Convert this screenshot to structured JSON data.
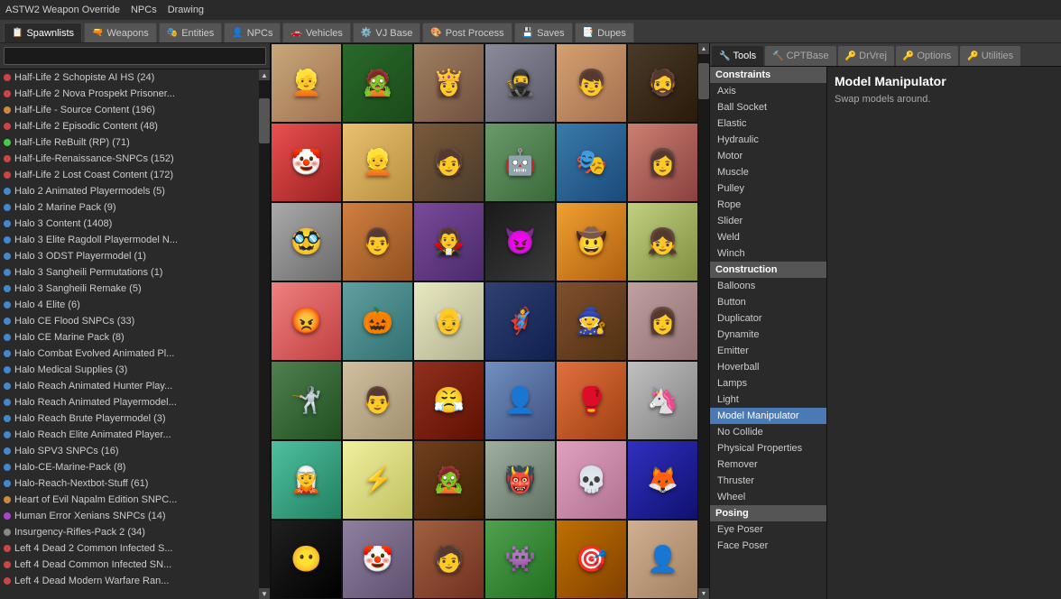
{
  "menubar": {
    "items": [
      "ASTW2 Weapon Override",
      "NPCs",
      "Drawing"
    ]
  },
  "tabs": [
    {
      "label": "Spawnlists",
      "icon": "📋",
      "active": true
    },
    {
      "label": "Weapons",
      "icon": "🔫",
      "active": false
    },
    {
      "label": "Entities",
      "icon": "🎭",
      "active": false
    },
    {
      "label": "NPCs",
      "icon": "👤",
      "active": false
    },
    {
      "label": "Vehicles",
      "icon": "🚗",
      "active": false
    },
    {
      "label": "VJ Base",
      "icon": "⚙️",
      "active": false
    },
    {
      "label": "Post Process",
      "icon": "🎨",
      "active": false
    },
    {
      "label": "Saves",
      "icon": "💾",
      "active": false
    },
    {
      "label": "Dupes",
      "icon": "📑",
      "active": false
    }
  ],
  "search": {
    "placeholder": ""
  },
  "list_items": [
    {
      "label": "Half-Life 2 Schopiste AI HS (24)",
      "color": "red"
    },
    {
      "label": "Half-Life 2 Nova Prospekt Prisoner...",
      "color": "red"
    },
    {
      "label": "Half-Life - Source Content (196)",
      "color": "orange"
    },
    {
      "label": "Half-Life 2 Episodic Content (48)",
      "color": "red"
    },
    {
      "label": "Half-Life ReBuilt (RP) (71)",
      "color": "green"
    },
    {
      "label": "Half-Life-Renaissance-SNPCs (152)",
      "color": "red"
    },
    {
      "label": "Half-Life 2 Lost Coast Content (172)",
      "color": "red"
    },
    {
      "label": "Halo 2 Animated Playermodels (5)",
      "color": "blue"
    },
    {
      "label": "Halo 2 Marine Pack (9)",
      "color": "blue"
    },
    {
      "label": "Halo 3 Content (1408)",
      "color": "blue"
    },
    {
      "label": "Halo 3 Elite Ragdoll Playermodel N...",
      "color": "blue"
    },
    {
      "label": "Halo 3 ODST Playermodel (1)",
      "color": "blue"
    },
    {
      "label": "Halo 3 Sangheili Permutations (1)",
      "color": "blue"
    },
    {
      "label": "Halo 3 Sangheili Remake (5)",
      "color": "blue"
    },
    {
      "label": "Halo 4 Elite (6)",
      "color": "blue"
    },
    {
      "label": "Halo CE Flood SNPCs (33)",
      "color": "blue"
    },
    {
      "label": "Halo CE Marine Pack (8)",
      "color": "blue"
    },
    {
      "label": "Halo Combat Evolved Animated Pl...",
      "color": "blue"
    },
    {
      "label": "Halo Medical Supplies (3)",
      "color": "blue"
    },
    {
      "label": "Halo Reach Animated Hunter Play...",
      "color": "blue"
    },
    {
      "label": "Halo Reach Animated Playermodel...",
      "color": "blue"
    },
    {
      "label": "Halo Reach Brute Playermodel (3)",
      "color": "blue"
    },
    {
      "label": "Halo Reach Elite Animated Player...",
      "color": "blue"
    },
    {
      "label": "Halo SPV3 SNPCs (16)",
      "color": "blue"
    },
    {
      "label": "Halo-CE-Marine-Pack (8)",
      "color": "blue"
    },
    {
      "label": "Halo-Reach-Nextbot-Stuff (61)",
      "color": "blue"
    },
    {
      "label": "Heart of Evil Napalm Edition SNPC...",
      "color": "orange"
    },
    {
      "label": "Human Error Xenians SNPCs (14)",
      "color": "purple"
    },
    {
      "label": "Insurgency-Rifles-Pack 2 (34)",
      "color": "gray"
    },
    {
      "label": "Left 4 Dead 2 Common Infected S...",
      "color": "red"
    },
    {
      "label": "Left 4 Dead Common Infected SN...",
      "color": "red"
    },
    {
      "label": "Left 4 Dead Modern Warfare Ran...",
      "color": "red"
    }
  ],
  "npc_grid": {
    "cells": [
      {
        "face": "face-1",
        "emoji": "👱"
      },
      {
        "face": "face-2",
        "emoji": "🧟"
      },
      {
        "face": "face-3",
        "emoji": "👸"
      },
      {
        "face": "face-4",
        "emoji": "🥷"
      },
      {
        "face": "face-5",
        "emoji": "👦"
      },
      {
        "face": "face-6",
        "emoji": "🧔"
      },
      {
        "face": "face-7",
        "emoji": "🤡"
      },
      {
        "face": "face-8",
        "emoji": "👱"
      },
      {
        "face": "face-9",
        "emoji": "🧑"
      },
      {
        "face": "face-10",
        "emoji": "🤖"
      },
      {
        "face": "face-11",
        "emoji": "🎭"
      },
      {
        "face": "face-12",
        "emoji": "👩"
      },
      {
        "face": "face-13",
        "emoji": "🥸"
      },
      {
        "face": "face-14",
        "emoji": "👨"
      },
      {
        "face": "face-15",
        "emoji": "🧛"
      },
      {
        "face": "face-16",
        "emoji": "😈"
      },
      {
        "face": "face-17",
        "emoji": "🤠"
      },
      {
        "face": "face-18",
        "emoji": "👧"
      },
      {
        "face": "face-19",
        "emoji": "😡"
      },
      {
        "face": "face-20",
        "emoji": "🎃"
      },
      {
        "face": "face-21",
        "emoji": "👴"
      },
      {
        "face": "face-22",
        "emoji": "🦸"
      },
      {
        "face": "face-23",
        "emoji": "🧙"
      },
      {
        "face": "face-24",
        "emoji": "👩"
      },
      {
        "face": "face-25",
        "emoji": "🤺"
      },
      {
        "face": "face-26",
        "emoji": "👨"
      },
      {
        "face": "face-27",
        "emoji": "😤"
      },
      {
        "face": "face-28",
        "emoji": "👤"
      },
      {
        "face": "face-29",
        "emoji": "🥊"
      },
      {
        "face": "face-30",
        "emoji": "🦄"
      },
      {
        "face": "face-31",
        "emoji": "🧝"
      },
      {
        "face": "face-32",
        "emoji": "⚡"
      },
      {
        "face": "face-33",
        "emoji": "🧟"
      },
      {
        "face": "face-34",
        "emoji": "👹"
      },
      {
        "face": "face-35",
        "emoji": "💀"
      },
      {
        "face": "face-36",
        "emoji": "🦊"
      },
      {
        "face": "face-37",
        "emoji": "😶"
      },
      {
        "face": "face-38",
        "emoji": "🤡"
      },
      {
        "face": "face-39",
        "emoji": "🧑"
      },
      {
        "face": "face-40",
        "emoji": "👾"
      },
      {
        "face": "face-41",
        "emoji": "🎯"
      },
      {
        "face": "face-42",
        "emoji": "👤"
      }
    ]
  },
  "right_tabs": [
    {
      "label": "Tools",
      "icon": "🔧",
      "active": true
    },
    {
      "label": "CPTBase",
      "icon": "🔨",
      "active": false
    },
    {
      "label": "DrVrej",
      "icon": "🔑",
      "active": false
    },
    {
      "label": "Options",
      "icon": "🔑",
      "active": false
    },
    {
      "label": "Utilities",
      "icon": "🔑",
      "active": false
    }
  ],
  "tools": {
    "sections": [
      {
        "header": "Constraints",
        "items": [
          "Axis",
          "Ball Socket",
          "Elastic",
          "Hydraulic",
          "Motor",
          "Muscle",
          "Pulley",
          "Rope",
          "Slider",
          "Weld",
          "Winch"
        ]
      },
      {
        "header": "Construction",
        "items": [
          "Balloons",
          "Button",
          "Duplicator",
          "Dynamite",
          "Emitter",
          "Hoverball",
          "Lamps",
          "Light",
          "Model Manipulator",
          "No Collide",
          "Physical Properties",
          "Remover",
          "Thruster",
          "Wheel"
        ]
      },
      {
        "header": "Posing",
        "items": [
          "Eye Poser",
          "Face Poser"
        ]
      }
    ],
    "selected": "Model Manipulator",
    "detail": {
      "title": "Model Manipulator",
      "description": "Swap models around."
    }
  }
}
